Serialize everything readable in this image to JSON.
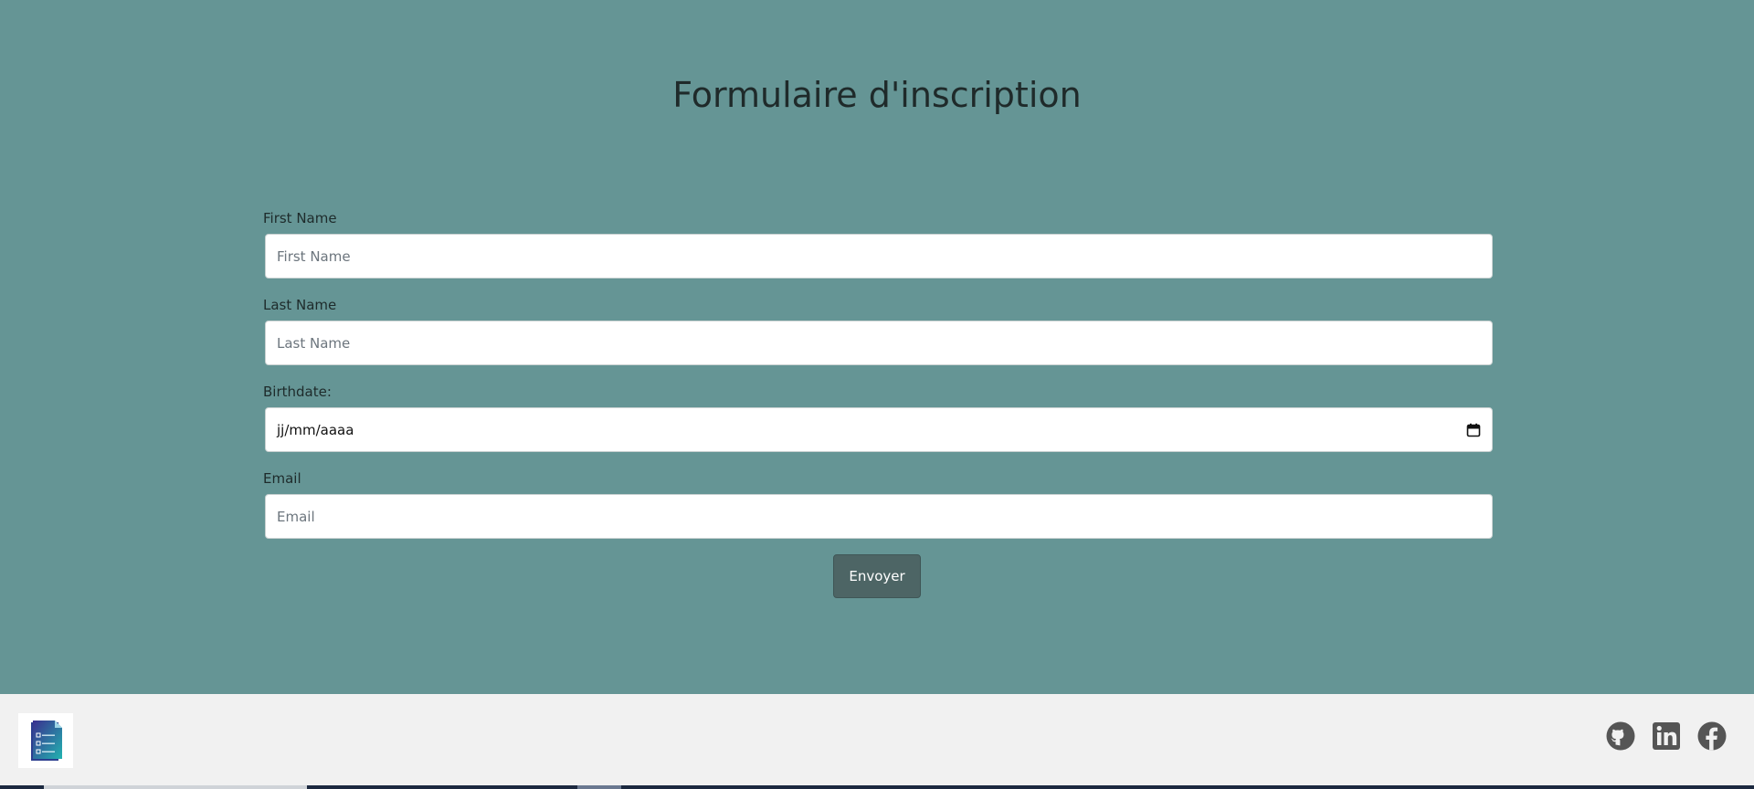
{
  "page": {
    "title": "Formulaire d'inscription"
  },
  "form": {
    "first_name": {
      "label": "First Name",
      "placeholder": "First Name",
      "value": ""
    },
    "last_name": {
      "label": "Last Name",
      "placeholder": "Last Name",
      "value": ""
    },
    "birthdate": {
      "label": "Birthdate:",
      "display": "jj/mm/aaaa"
    },
    "email": {
      "label": "Email",
      "placeholder": "Email",
      "value": ""
    },
    "submit_label": "Envoyer"
  },
  "footer": {
    "logo_icon": "form-document-icon",
    "social": [
      {
        "icon": "github-icon"
      },
      {
        "icon": "linkedin-icon"
      },
      {
        "icon": "facebook-icon"
      }
    ]
  },
  "colors": {
    "background": "#659595",
    "footer_background": "#f1f1f1",
    "button": "#4d6565",
    "social_icon": "#555555"
  }
}
